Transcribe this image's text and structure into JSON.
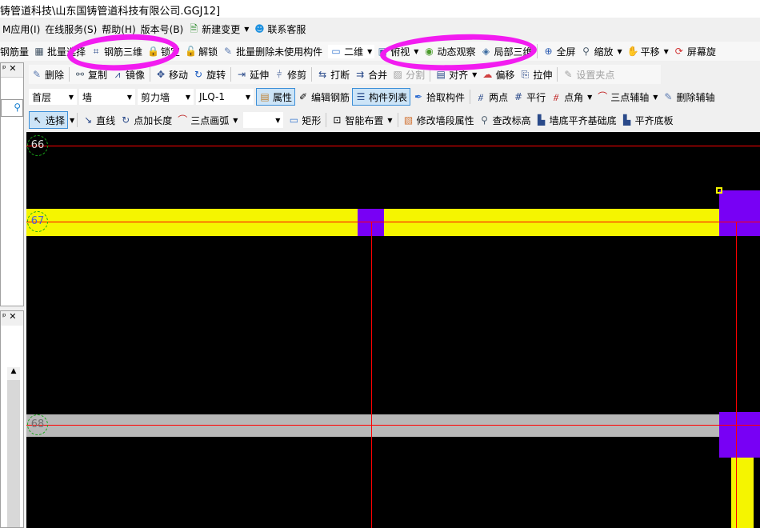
{
  "window": {
    "title": "铸管道科技\\山东国铸管道科技有限公司.GGJ12]"
  },
  "menu": {
    "items": [
      "M应用(I)",
      "在线服务(S)",
      "帮助(H)",
      "版本号(B)"
    ],
    "new_change": "新建变更",
    "support": "联系客服"
  },
  "toolbar1": {
    "items": [
      "钢筋量",
      "批量选择",
      "钢筋三维",
      "锁定",
      "解锁",
      "批量删除未使用构件"
    ],
    "view_mode": "二维",
    "top_view": "俯视",
    "dynamic": "动态观察",
    "local3d": "局部三维",
    "fullscreen": "全屏",
    "zoom": "缩放",
    "pan": "平移",
    "rotate": "屏幕旋"
  },
  "toolbar2": {
    "items": [
      "删除",
      "复制",
      "镜像",
      "移动",
      "旋转",
      "延伸",
      "修剪",
      "打断",
      "合并",
      "分割",
      "对齐",
      "偏移",
      "拉伸",
      "设置夹点"
    ]
  },
  "toolbar3": {
    "floor": "首层",
    "type": "墙",
    "subtype": "剪力墙",
    "component": "JLQ-1",
    "property": "属性",
    "edit_rebar": "编辑钢筋",
    "component_list": "构件列表",
    "pick": "拾取构件",
    "two_point": "两点",
    "parallel": "平行",
    "point_angle": "点角",
    "three_point_axis": "三点辅轴",
    "delete_axis": "删除辅轴"
  },
  "toolbar4": {
    "select": "选择",
    "line": "直线",
    "point_length": "点加长度",
    "arc": "三点画弧",
    "combo_value": "",
    "rect": "矩形",
    "smart_layout": "智能布置",
    "modify_wall": "修改墙段属性",
    "modify_elev": "查改标高",
    "wall_bottom": "墙底平齐基础底",
    "slab_bottom": "平齐底板"
  },
  "canvas": {
    "axes": [
      "66",
      "67",
      "68"
    ],
    "colors": {
      "beam": "#f5f500",
      "column": "#7800f5",
      "wall_gray": "#b8b8b8",
      "axis_line": "#ff0000",
      "background": "#000000"
    }
  },
  "annotations": {
    "highlight_color": "#f21cf0"
  }
}
